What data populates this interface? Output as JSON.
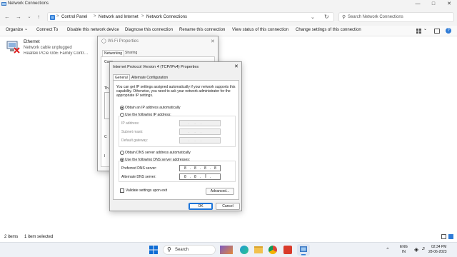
{
  "window": {
    "title": "Network Connections"
  },
  "address": {
    "crumbs": [
      "Control Panel",
      "Network and Internet",
      "Network Connections"
    ],
    "separator": ">"
  },
  "search": {
    "placeholder": "Search Network Connections"
  },
  "toolbar": {
    "organize": "Organize",
    "connect_to": "Connect To",
    "disable": "Disable this network device",
    "diagnose": "Diagnose this connection",
    "rename": "Rename this connection",
    "view_status": "View status of this connection",
    "change_settings": "Change settings of this connection"
  },
  "ethernet": {
    "name": "Ethernet",
    "status": "Network cable unplugged",
    "adapter": "Realtek PCIe GbE Family Controller"
  },
  "wifi_props": {
    "title": "Wi-Fi Properties",
    "tabs": [
      "Networking",
      "Sharing"
    ],
    "partial_labels": [
      "Conn",
      "Th",
      "C",
      "I"
    ]
  },
  "ipv4": {
    "title": "Internet Protocol Version 4 (TCP/IPv4) Properties",
    "tabs": [
      "General",
      "Alternate Configuration"
    ],
    "description": "You can get IP settings assigned automatically if your network supports this capability. Otherwise, you need to ask your network administrator for the appropriate IP settings.",
    "obtain_ip_auto": "Obtain an IP address automatically",
    "use_following_ip": "Use the following IP address:",
    "ip_address": "IP address:",
    "subnet_mask": "Subnet mask:",
    "default_gateway": "Default gateway:",
    "obtain_dns_auto": "Obtain DNS server address automatically",
    "use_following_dns": "Use the following DNS server addresses:",
    "preferred_dns": "Preferred DNS server:",
    "alternate_dns": "Alternate DNS server:",
    "preferred_dns_octets": [
      "8",
      "8",
      "8",
      "8"
    ],
    "alternate_dns_octets": [
      "8",
      "8",
      "",
      ""
    ],
    "validate": "Validate settings upon exit",
    "advanced": "Advanced...",
    "ok": "OK",
    "cancel": "Cancel"
  },
  "status": {
    "items": "2 items",
    "selected": "1 item selected"
  },
  "taskbar": {
    "search": "Search",
    "language": "ENG",
    "region": "IN",
    "time": "02:34 PM",
    "date": "28-06-2023"
  },
  "colors": {
    "accent": "#1a73d9",
    "taskbar": "#eef1f6"
  }
}
